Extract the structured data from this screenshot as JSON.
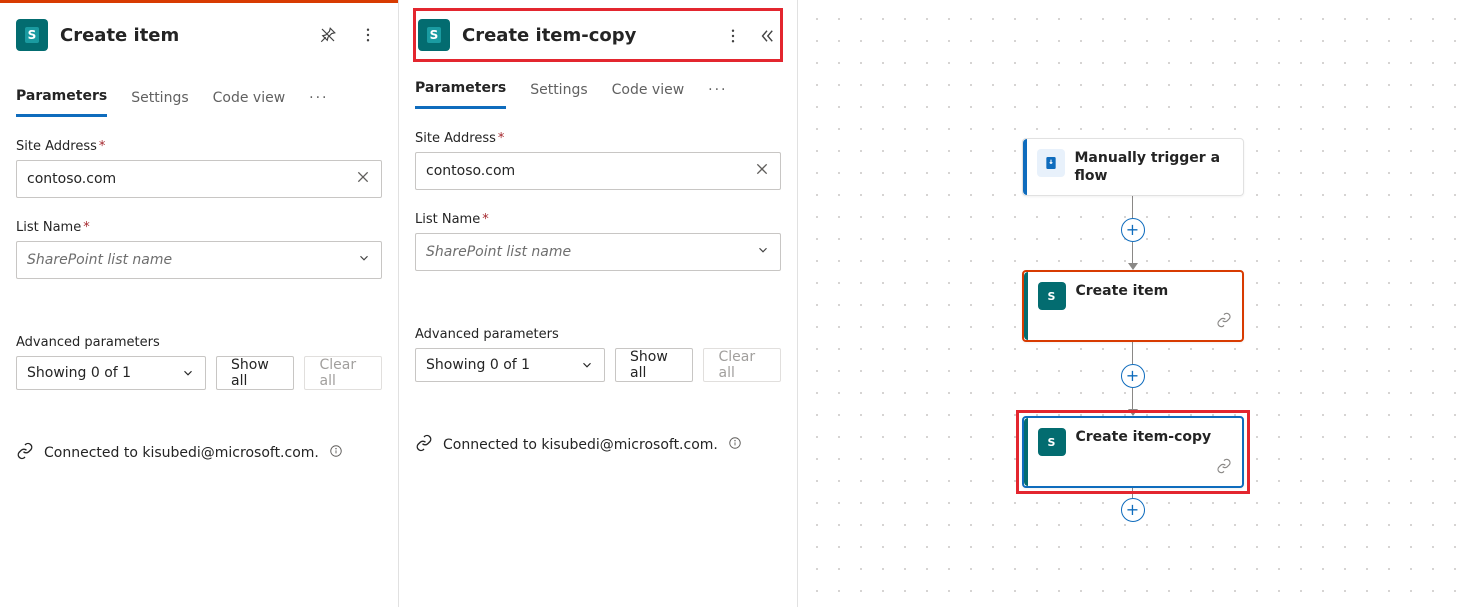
{
  "panelLeft": {
    "title": "Create item",
    "tab_param": "Parameters",
    "tab_settings": "Settings",
    "tab_code": "Code view",
    "siteAddressLabel": "Site Address",
    "siteAddressValue": "contoso.com",
    "listNameLabel": "List Name",
    "listNamePlaceholder": "SharePoint list name",
    "advLabel": "Advanced parameters",
    "advSelect": "Showing 0 of 1",
    "showAll": "Show all",
    "clearAll": "Clear all",
    "connectedTo": "Connected to kisubedi@microsoft.com."
  },
  "panelRight": {
    "title": "Create item-copy",
    "tab_param": "Parameters",
    "tab_settings": "Settings",
    "tab_code": "Code view",
    "siteAddressLabel": "Site Address",
    "siteAddressValue": "contoso.com",
    "listNameLabel": "List Name",
    "listNamePlaceholder": "SharePoint list name",
    "advLabel": "Advanced parameters",
    "advSelect": "Showing 0 of 1",
    "showAll": "Show all",
    "clearAll": "Clear all",
    "connectedTo": "Connected to kisubedi@microsoft.com."
  },
  "canvas": {
    "trigger": "Manually trigger a flow",
    "action1": "Create item",
    "action2": "Create item-copy"
  }
}
